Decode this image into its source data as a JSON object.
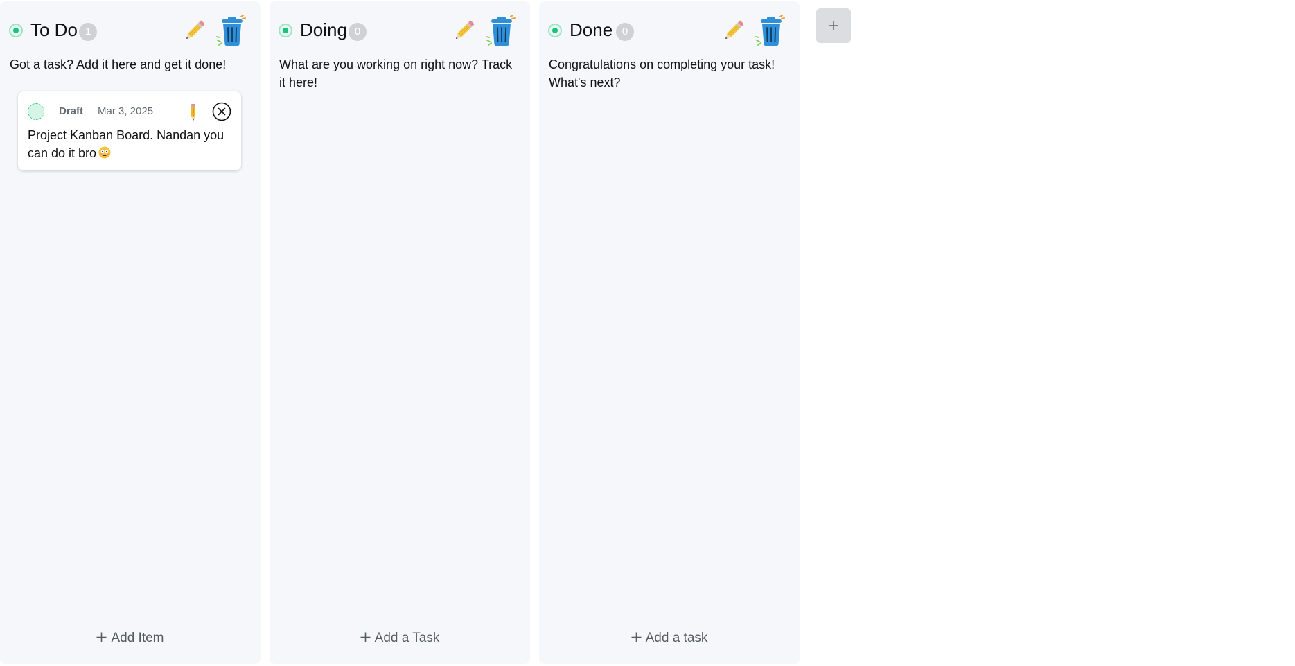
{
  "columns": [
    {
      "title": "To Do",
      "count": "1",
      "description": "Got a task? Add it here and get it done!",
      "add_label": "Add Item",
      "tasks": [
        {
          "label": "Draft",
          "date": "Mar 3, 2025",
          "text": "Project Kanban Board. Nandan you can do it bro",
          "emoji_icon": "flushed-face-icon"
        }
      ]
    },
    {
      "title": "Doing",
      "count": "0",
      "description": "What are you working on right now? Track it here!",
      "add_label": "Add a Task",
      "tasks": []
    },
    {
      "title": "Done",
      "count": "0",
      "description": "Congratulations on completing your task! What's next?",
      "add_label": "Add a task",
      "tasks": []
    }
  ],
  "add_column_icon": "plus-icon",
  "colors": {
    "column_bg": "#f5f7fb",
    "status_green": "#1ec27e",
    "badge_grey": "#cfd1d4",
    "trash_blue": "#2f8fd8",
    "add_column_bg": "#dcdde0"
  }
}
